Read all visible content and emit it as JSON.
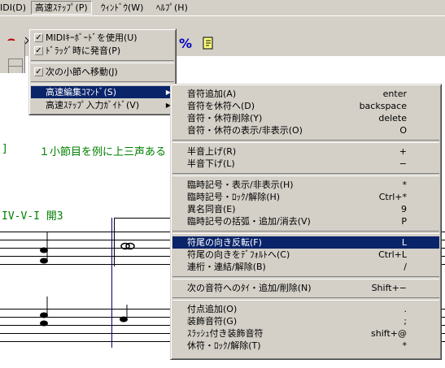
{
  "menubar": {
    "items": [
      {
        "label": "IDI(D)"
      },
      {
        "label": "高速ｽﾃｯﾌﾟ(P)"
      },
      {
        "label": "ｳｨﾝﾄﾞｳ(W)"
      },
      {
        "label": "ﾍﾙﾌﾟ(H)"
      }
    ]
  },
  "toolbar": {
    "percent_icon": "%",
    "page_icon": "page-icon"
  },
  "document": {
    "line1_prefix": "]",
    "line1_text": "１小節目を例に上三声ある",
    "line2_text": "IV-V-I  開3"
  },
  "menu_main": {
    "items": [
      {
        "label": "MIDIｷｰﾎﾞｰﾄﾞを使用(U)",
        "checked": true
      },
      {
        "label": "ﾄﾞﾗｯｸﾞ時に発音(P)",
        "checked": true
      },
      {
        "label": "次の小節へ移動(J)",
        "checked": true
      },
      {
        "label": "高速編集ｺﾏﾝﾄﾞ(S)",
        "submenu": true
      },
      {
        "label": "高速ｽﾃｯﾌﾟ入力ｶﾞｲﾄﾞ(V)",
        "submenu": true
      }
    ]
  },
  "menu_sub": {
    "groups": [
      [
        {
          "label": "音符追加(A)",
          "shortcut": "enter"
        },
        {
          "label": "音符を休符へ(D)",
          "shortcut": "backspace"
        },
        {
          "label": "音符・休符削除(Y)",
          "shortcut": "delete"
        },
        {
          "label": "音符・休符の表示/非表示(O)",
          "shortcut": "O"
        }
      ],
      [
        {
          "label": "半音上げ(R)",
          "shortcut": "+"
        },
        {
          "label": "半音下げ(L)",
          "shortcut": "−"
        }
      ],
      [
        {
          "label": "臨時記号・表示/非表示(H)",
          "shortcut": "*"
        },
        {
          "label": "臨時記号・ﾛｯｸ/解除(H)",
          "shortcut": "Ctrl+*"
        },
        {
          "label": "異名同音(E)",
          "shortcut": "9"
        },
        {
          "label": "臨時記号の括弧・追加/消去(V)",
          "shortcut": "P"
        }
      ],
      [
        {
          "label": "符尾の向き反転(F)",
          "shortcut": "L",
          "highlighted": true
        },
        {
          "label": "符尾の向きをﾃﾞﾌｫﾙﾄへ(C)",
          "shortcut": "Ctrl+L"
        },
        {
          "label": "連桁・連結/解除(B)",
          "shortcut": "/"
        }
      ],
      [
        {
          "label": "次の音符へのﾀｲ・追加/削除(N)",
          "shortcut": "Shift+−"
        }
      ],
      [
        {
          "label": "付点追加(O)",
          "shortcut": "."
        },
        {
          "label": "装飾音符(G)",
          "shortcut": ";"
        },
        {
          "label": "ｽﾗｯｼｭ付き装飾音符",
          "shortcut": "shift+@"
        },
        {
          "label": "休符・ﾛｯｸ/解除(T)",
          "shortcut": "*"
        }
      ]
    ]
  },
  "colors": {
    "menu_bg": "#d4d0c8",
    "highlight": "#0a246a",
    "green_text": "#008000"
  }
}
